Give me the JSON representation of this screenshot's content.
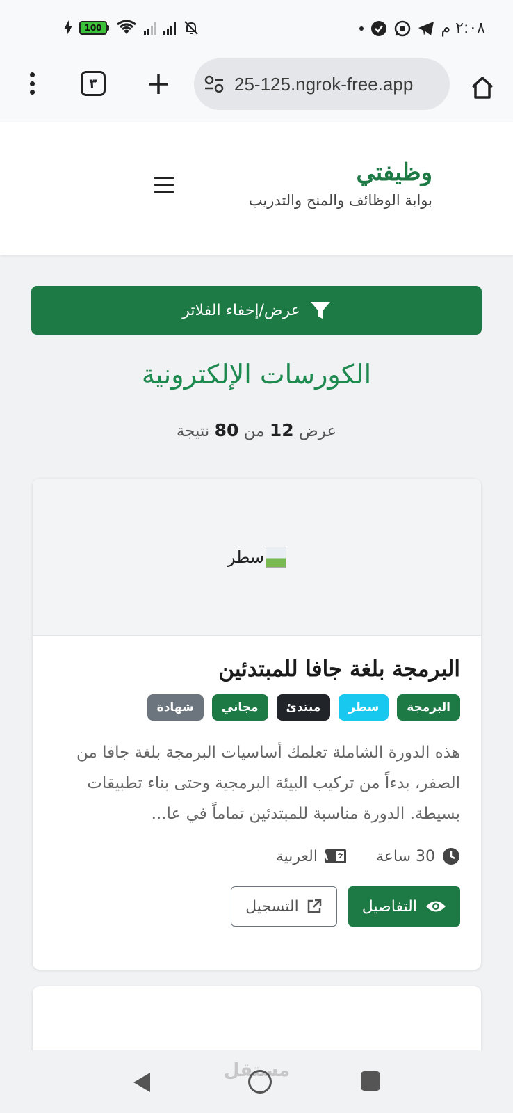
{
  "status_bar": {
    "time": "٢:٠٨ م",
    "battery": "100"
  },
  "browser": {
    "url": "25-125.ngrok-free.app",
    "tab_count": "٣"
  },
  "site": {
    "name": "وظيفتي",
    "tagline": "بوابة الوظائف والمنح والتدريب"
  },
  "filter_button": {
    "label": "عرض/إخفاء الفلاتر"
  },
  "page": {
    "title": "الكورسات الإلكترونية",
    "results_prefix": "عرض",
    "results_shown": "12",
    "results_mid": "من",
    "results_total": "80",
    "results_suffix": "نتيجة"
  },
  "courses": [
    {
      "image_alt": "سطر",
      "title": "البرمجة بلغة جافا للمبتدئين",
      "badges": [
        {
          "label": "البرمجة",
          "color": "#1e7a45"
        },
        {
          "label": "سطر",
          "color": "#18c8ee"
        },
        {
          "label": "مبتدئ",
          "color": "#212529"
        },
        {
          "label": "مجاني",
          "color": "#1e7a45"
        },
        {
          "label": "شهادة",
          "color": "#6c757d"
        }
      ],
      "description": "هذه الدورة الشاملة تعلمك أساسيات البرمجة بلغة جافا من الصفر، بدءاً من تركيب البيئة البرمجية وحتى بناء تطبيقات بسيطة. الدورة مناسبة للمبتدئين تماماً في عا...",
      "duration": "30 ساعة",
      "language": "العربية",
      "details_label": "التفاصيل",
      "register_label": "التسجيل"
    }
  ],
  "watermark": "مستقل"
}
